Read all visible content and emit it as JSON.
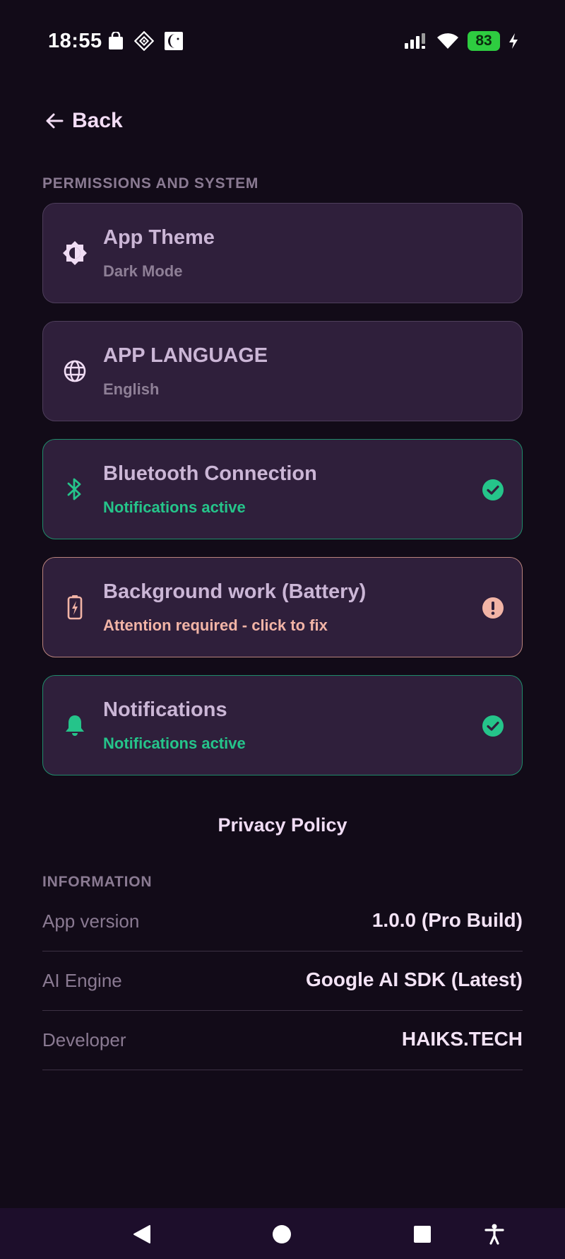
{
  "status_bar": {
    "time": "18:55",
    "battery": "83",
    "left_icons": [
      "shopping-bag-icon",
      "diamond-grid-icon",
      "moon-face-icon"
    ],
    "right_icons": [
      "signal-icon",
      "wifi-icon",
      "battery-icon",
      "charging-icon"
    ]
  },
  "header": {
    "back_label": "Back"
  },
  "sections": {
    "permissions_title": "PERMISSIONS AND SYSTEM",
    "information_title": "INFORMATION"
  },
  "cards": [
    {
      "title": "App Theme",
      "subtitle": "Dark Mode",
      "icon": "theme-icon",
      "state": "neutral"
    },
    {
      "title": "APP LANGUAGE",
      "subtitle": "English",
      "icon": "globe-icon",
      "state": "neutral"
    },
    {
      "title": "Bluetooth Connection",
      "subtitle": "Notifications active",
      "icon": "bluetooth-icon",
      "state": "ok"
    },
    {
      "title": "Background work (Battery)",
      "subtitle": "Attention required - click to fix",
      "icon": "battery-alert-icon",
      "state": "warn"
    },
    {
      "title": "Notifications",
      "subtitle": "Notifications active",
      "icon": "bell-icon",
      "state": "ok"
    }
  ],
  "privacy_policy": "Privacy Policy",
  "info": [
    {
      "label": "App version",
      "value": "1.0.0 (Pro Build)"
    },
    {
      "label": "AI Engine",
      "value": "Google AI SDK (Latest)"
    },
    {
      "label": "Developer",
      "value": "HAIKS.TECH"
    }
  ],
  "colors": {
    "background": "#120b18",
    "card": "#2f1f3b",
    "ok": "#25c48a",
    "warn": "#f2b4a6",
    "nav_bar": "#1d0e2b"
  }
}
